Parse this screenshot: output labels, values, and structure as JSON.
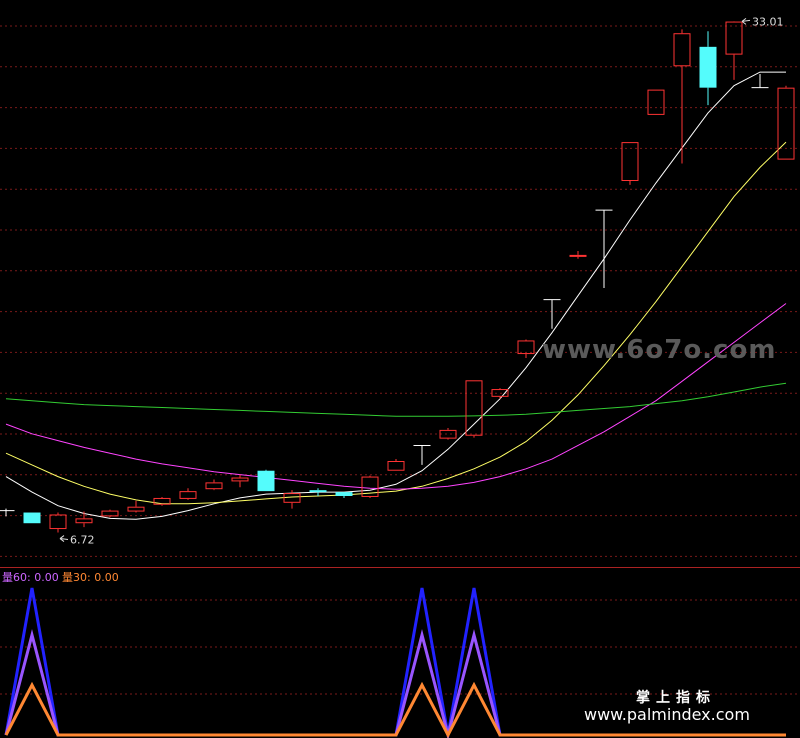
{
  "chart_data": [
    {
      "type": "candlestick",
      "panel": "price",
      "ylim": [
        5.0,
        33.8
      ],
      "up_color": "#ff3333",
      "down_color": "#54fcfc",
      "grid": true,
      "annotations": {
        "high_label": "33.01",
        "low_label": "6.72"
      },
      "candles": [
        {
          "o": 7.85,
          "h": 7.95,
          "l": 7.55,
          "c": 7.85
        },
        {
          "o": 7.75,
          "h": 7.75,
          "l": 7.2,
          "c": 7.2
        },
        {
          "o": 6.9,
          "h": 7.75,
          "l": 6.72,
          "c": 7.65
        },
        {
          "o": 7.2,
          "h": 7.8,
          "l": 7.0,
          "c": 7.45
        },
        {
          "o": 7.55,
          "h": 7.9,
          "l": 7.5,
          "c": 7.85
        },
        {
          "o": 7.8,
          "h": 8.35,
          "l": 7.75,
          "c": 8.05
        },
        {
          "o": 8.15,
          "h": 8.55,
          "l": 8.1,
          "c": 8.5
        },
        {
          "o": 8.45,
          "h": 9.0,
          "l": 8.4,
          "c": 8.85
        },
        {
          "o": 8.95,
          "h": 9.45,
          "l": 8.9,
          "c": 9.3
        },
        {
          "o": 9.35,
          "h": 9.7,
          "l": 9.05,
          "c": 9.55
        },
        {
          "o": 9.9,
          "h": 9.95,
          "l": 8.85,
          "c": 8.85
        },
        {
          "o": 8.25,
          "h": 8.9,
          "l": 7.95,
          "c": 8.75
        },
        {
          "o": 8.9,
          "h": 9.0,
          "l": 8.6,
          "c": 8.8
        },
        {
          "o": 8.8,
          "h": 8.8,
          "l": 8.5,
          "c": 8.6
        },
        {
          "o": 8.55,
          "h": 9.65,
          "l": 8.5,
          "c": 9.6
        },
        {
          "o": 9.9,
          "h": 10.5,
          "l": 9.9,
          "c": 10.4
        },
        {
          "o": 11.2,
          "h": 11.2,
          "l": 10.2,
          "c": 11.2
        },
        {
          "o": 11.55,
          "h": 12.1,
          "l": 11.5,
          "c": 12.0
        },
        {
          "o": 11.7,
          "h": 14.55,
          "l": 11.6,
          "c": 14.55
        },
        {
          "o": 13.7,
          "h": 14.15,
          "l": 13.6,
          "c": 14.1
        },
        {
          "o": 15.9,
          "h": 16.65,
          "l": 15.7,
          "c": 16.6
        },
        {
          "o": 18.7,
          "h": 18.7,
          "l": 17.2,
          "c": 18.7
        },
        {
          "o": 20.9,
          "h": 21.2,
          "l": 20.8,
          "c": 21.0
        },
        {
          "o": 23.3,
          "h": 23.3,
          "l": 19.3,
          "c": 23.3
        },
        {
          "o": 24.8,
          "h": 26.8,
          "l": 24.6,
          "c": 26.8
        },
        {
          "o": 28.2,
          "h": 29.5,
          "l": 28.2,
          "c": 29.5
        },
        {
          "o": 30.7,
          "h": 32.6,
          "l": 25.7,
          "c": 32.4
        },
        {
          "o": 31.7,
          "h": 32.5,
          "l": 28.7,
          "c": 29.6
        },
        {
          "o": 31.3,
          "h": 33.01,
          "l": 30.0,
          "c": 33.0
        },
        {
          "o": 29.6,
          "h": 30.3,
          "l": 29.6,
          "c": 29.6
        },
        {
          "o": 25.9,
          "h": 29.7,
          "l": 25.9,
          "c": 29.6
        }
      ],
      "series": [
        {
          "color": "#ffffff",
          "values": [
            9.6,
            8.8,
            8.1,
            7.7,
            7.45,
            7.4,
            7.55,
            7.85,
            8.2,
            8.5,
            8.7,
            8.75,
            8.8,
            8.8,
            8.9,
            9.2,
            9.9,
            11.0,
            12.3,
            13.6,
            15.2,
            17.0,
            18.9,
            20.8,
            22.8,
            24.7,
            26.5,
            28.3,
            29.7,
            30.4,
            30.4
          ]
        },
        {
          "color": "#ffff66",
          "values": [
            10.8,
            10.2,
            9.6,
            9.1,
            8.7,
            8.4,
            8.2,
            8.2,
            8.25,
            8.35,
            8.45,
            8.55,
            8.6,
            8.65,
            8.75,
            8.85,
            9.1,
            9.5,
            10.0,
            10.6,
            11.4,
            12.5,
            13.8,
            15.3,
            16.9,
            18.6,
            20.4,
            22.2,
            24.0,
            25.5,
            26.8
          ]
        },
        {
          "color": "#ff44ff",
          "values": [
            12.3,
            11.8,
            11.45,
            11.1,
            10.8,
            10.5,
            10.25,
            10.05,
            9.85,
            9.7,
            9.55,
            9.4,
            9.25,
            9.1,
            9.0,
            8.95,
            9.0,
            9.1,
            9.3,
            9.6,
            10.0,
            10.5,
            11.2,
            11.9,
            12.7,
            13.5,
            14.5,
            15.5,
            16.5,
            17.5,
            18.5
          ]
        },
        {
          "color": "#33cc33",
          "values": [
            13.6,
            13.5,
            13.4,
            13.3,
            13.25,
            13.2,
            13.15,
            13.1,
            13.05,
            13.0,
            12.95,
            12.9,
            12.85,
            12.8,
            12.75,
            12.7,
            12.7,
            12.7,
            12.72,
            12.75,
            12.8,
            12.9,
            13.0,
            13.1,
            13.2,
            13.35,
            13.5,
            13.7,
            13.95,
            14.2,
            14.4
          ]
        }
      ]
    },
    {
      "type": "line",
      "panel": "indicator",
      "ylim": [
        0,
        1
      ],
      "legend_labels": [
        "量60: 0.00",
        "量30: 0.00"
      ],
      "legend_colors": [
        "#cc66ff",
        "#ff8833"
      ],
      "series": [
        {
          "color": "#2222ff",
          "values": [
            0,
            1,
            0,
            0,
            0,
            0,
            0,
            0,
            0,
            0,
            0,
            0,
            0,
            0,
            0,
            0,
            1,
            0,
            1,
            0,
            0,
            0,
            0,
            0,
            0,
            0,
            0,
            0,
            0,
            0,
            0
          ]
        },
        {
          "color": "#9955ff",
          "values": [
            0,
            0.68,
            0,
            0,
            0,
            0,
            0,
            0,
            0,
            0,
            0,
            0,
            0,
            0,
            0,
            0,
            0.68,
            0,
            0.68,
            0,
            0,
            0,
            0,
            0,
            0,
            0,
            0,
            0,
            0,
            0,
            0
          ]
        },
        {
          "color": "#ff8833",
          "values": [
            0,
            0.34,
            0,
            0,
            0,
            0,
            0,
            0,
            0,
            0,
            0,
            0,
            0,
            0,
            0,
            0,
            0.34,
            0,
            0.34,
            0,
            0,
            0,
            0,
            0,
            0,
            0,
            0,
            0,
            0,
            0,
            0
          ]
        }
      ]
    }
  ],
  "watermarks": {
    "center": "www.6o7o.com",
    "brand_cn": "掌上指标",
    "brand_url": "www.palmindex.com"
  }
}
